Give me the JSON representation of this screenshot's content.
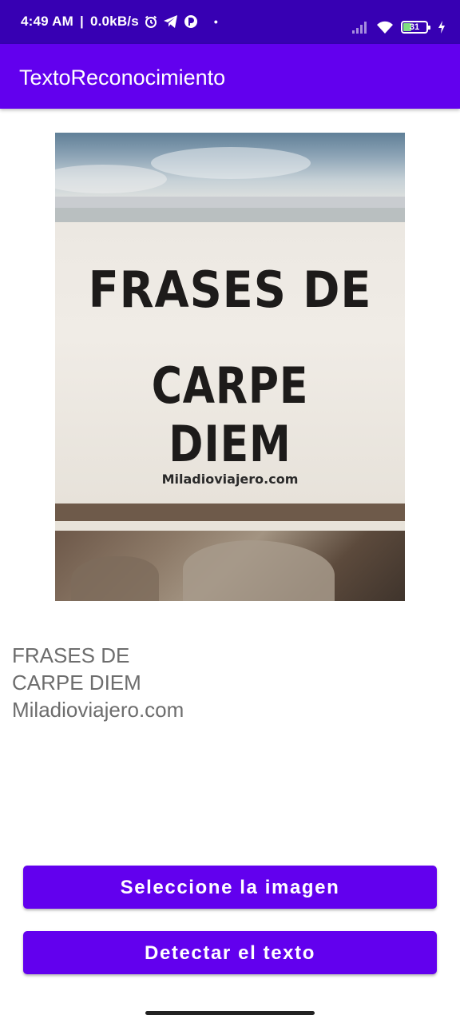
{
  "status_bar": {
    "time": "4:49 AM",
    "separator": "|",
    "net_speed": "0.0kB/s",
    "dot": "•",
    "battery_level": "31",
    "icons": [
      "alarm-icon",
      "telegram-icon",
      "app-notification-icon",
      "signal-icon",
      "wifi-icon",
      "battery-icon",
      "charging-icon"
    ]
  },
  "app_bar": {
    "title": "TextoReconocimiento",
    "color": "#6200ee"
  },
  "image": {
    "line1": "FRASES DE",
    "line2": "CARPE DIEM",
    "site": "Miladioviajero.com"
  },
  "result": {
    "lines": [
      "FRASES DE",
      "CARPE DIEM",
      "Miladioviajero.com"
    ]
  },
  "buttons": {
    "select_image": "Seleccione la imagen",
    "detect_text": "Detectar el texto"
  },
  "colors": {
    "status_bar": "#3700b3",
    "primary": "#6200ee",
    "result_text": "#6d6d6d"
  }
}
